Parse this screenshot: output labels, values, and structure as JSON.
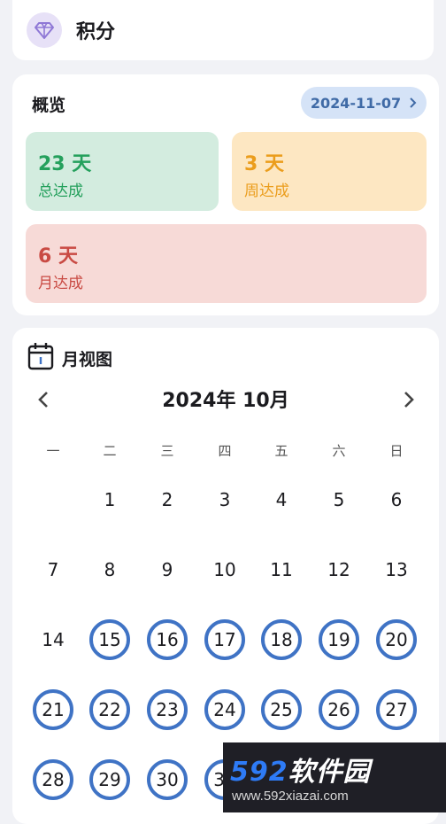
{
  "header": {
    "title": "积分",
    "icon": "gem-icon",
    "accent": "#8f78d6"
  },
  "overview": {
    "title": "概览",
    "date": "2024-11-07",
    "stats": [
      {
        "value": "23 天",
        "label": "总达成",
        "color": "#24a05c"
      },
      {
        "value": "3 天",
        "label": "周达成",
        "color": "#eb9d1c"
      },
      {
        "value": "6 天",
        "label": "月达成",
        "color": "#c94a43"
      }
    ]
  },
  "month_view": {
    "title": "月视图",
    "month_label": "2024年 10月",
    "weekdays": [
      "一",
      "二",
      "三",
      "四",
      "五",
      "六",
      "日"
    ],
    "first_weekday_index": 1,
    "days_in_month": 31,
    "completed_days": [
      15,
      16,
      17,
      18,
      19,
      20,
      21,
      22,
      23,
      24,
      25,
      26,
      27,
      28,
      29,
      30,
      31
    ],
    "ring_color": "#3f73c5"
  },
  "watermark": {
    "logo_num": "592",
    "logo_text": "软件园",
    "url": "www.592xiazai.com"
  }
}
